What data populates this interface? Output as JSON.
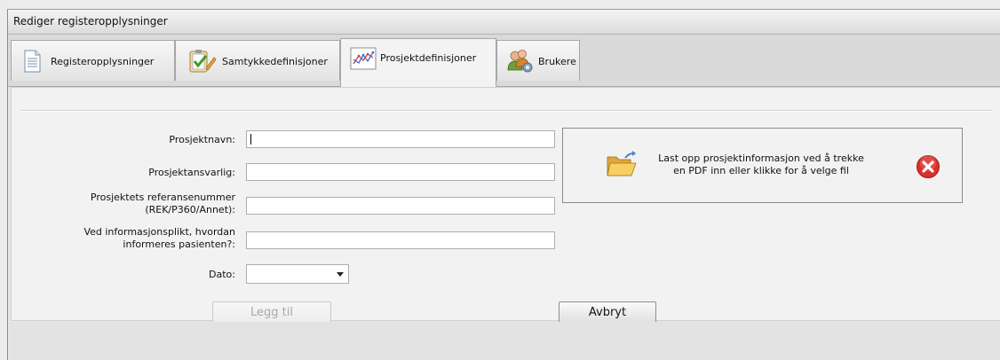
{
  "window": {
    "title": "Rediger registeropplysninger"
  },
  "tabs": [
    {
      "label": "Registeropplysninger",
      "icon": "document-icon",
      "active": false
    },
    {
      "label": "Samtykkedefinisjoner",
      "icon": "clipboard-check-icon",
      "active": false
    },
    {
      "label": "Prosjektdefinisjoner",
      "icon": "line-chart-icon",
      "active": true
    },
    {
      "label": "Brukere",
      "icon": "users-gear-icon",
      "active": false
    }
  ],
  "form": {
    "project_name": {
      "label": "Prosjektnavn:",
      "value": ""
    },
    "project_responsible": {
      "label": "Prosjektansvarlig:",
      "value": ""
    },
    "reference_number": {
      "label_line1": "Prosjektets referansenummer",
      "label_line2": "(REK/P360/Annet):",
      "value": ""
    },
    "inform_patient": {
      "label_line1": "Ved informasjonsplikt, hvordan",
      "label_line2": "informeres pasienten?:",
      "value": ""
    },
    "date": {
      "label": "Dato:",
      "value": ""
    }
  },
  "upload": {
    "line1": "Last opp prosjektinformasjon ved å trekke",
    "line2": "en PDF inn eller klikke for å velge fil",
    "icon": "open-folder-icon",
    "remove_icon": "close-circle-icon"
  },
  "buttons": {
    "add": "Legg til",
    "cancel": "Avbryt"
  },
  "colors": {
    "remove_red": "#d9302a",
    "folder_yellow": "#f2c14e"
  }
}
